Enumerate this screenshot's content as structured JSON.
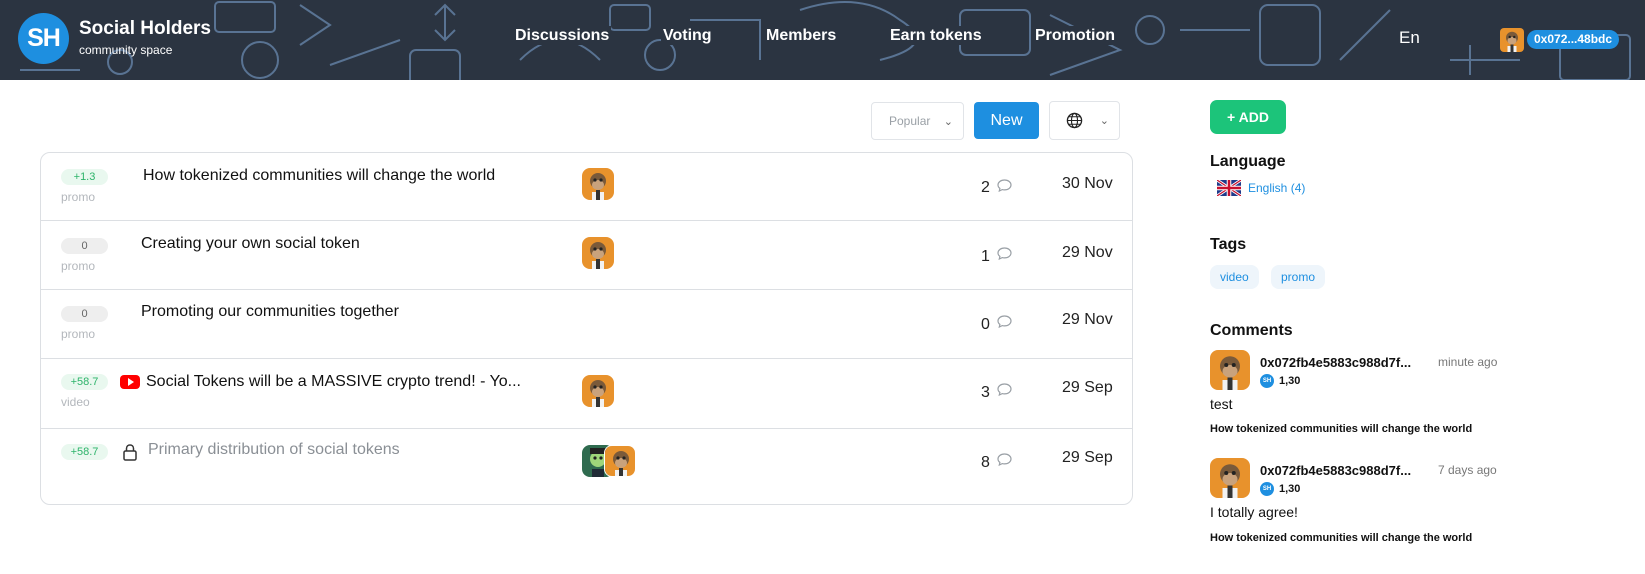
{
  "header": {
    "logo_text": "SH",
    "title": "Social Holders",
    "subtitle": "community space",
    "nav": [
      "Discussions",
      "Voting",
      "Members",
      "Earn tokens",
      "Promotion"
    ],
    "language": "En",
    "user_address": "0x072...48bdc",
    "colors": {
      "header_bg": "#2b3441",
      "accent": "#1e8fe0"
    }
  },
  "toolbar": {
    "sort_value": "Popular",
    "new_label": "New",
    "globe_icon": "globe-icon"
  },
  "topics": [
    {
      "score": "+1.3",
      "tag": "promo",
      "title": "How tokenized communities will change the world",
      "comments": "2",
      "date": "30 Nov"
    },
    {
      "score": "0",
      "tag": "promo",
      "title": "Creating your own social token",
      "comments": "1",
      "date": "29 Nov"
    },
    {
      "score": "0",
      "tag": "promo",
      "title": "Promoting our communities together",
      "comments": "0",
      "date": "29 Nov"
    },
    {
      "score": "+58.7",
      "tag": "video",
      "title": "Social Tokens will be a MASSIVE crypto trend! - Yo...",
      "comments": "3",
      "date": "29 Sep"
    },
    {
      "score": "+58.7",
      "tag": "",
      "title": "Primary distribution of social tokens",
      "comments": "8",
      "date": "29 Sep"
    }
  ],
  "sidebar": {
    "add_label": "+ ADD",
    "language_heading": "Language",
    "language_link": "English (4)",
    "tags_heading": "Tags",
    "tags": [
      "video",
      "promo"
    ],
    "comments_heading": "Comments",
    "comments": [
      {
        "author": "0x072fb4e5883c988d7f...",
        "time": "minute ago",
        "token": "SH",
        "balance": "1,30",
        "text": "test",
        "topic": "How tokenized communities will change the world"
      },
      {
        "author": "0x072fb4e5883c988d7f...",
        "time": "7 days ago",
        "token": "SH",
        "balance": "1,30",
        "text": "I totally agree!",
        "topic": "How tokenized communities will change the world"
      }
    ]
  }
}
